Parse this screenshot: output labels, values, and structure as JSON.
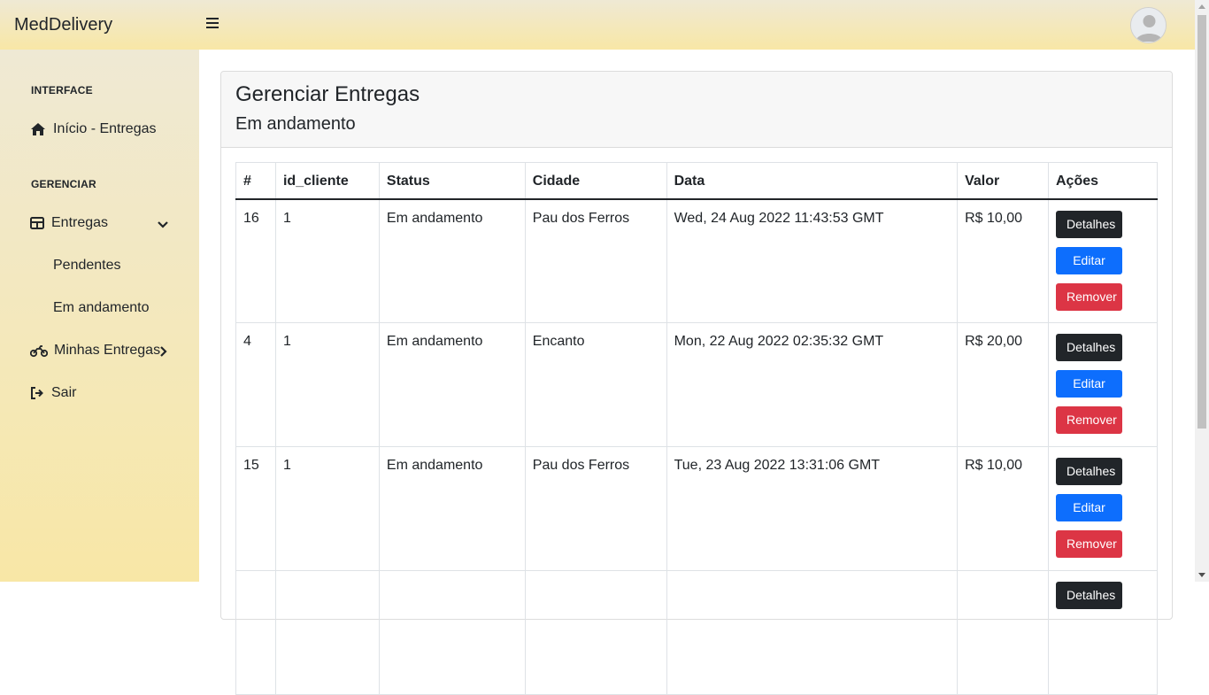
{
  "app": {
    "brand": "MedDelivery"
  },
  "sidebar": {
    "heading_interface": "INTERFACE",
    "inicio": "Início - Entregas",
    "heading_gerenciar": "GERENCIAR",
    "entregas": "Entregas",
    "sub_pendentes": "Pendentes",
    "sub_em_andamento": "Em andamento",
    "minhas_entregas": "Minhas Entregas",
    "sair": "Sair"
  },
  "page": {
    "title": "Gerenciar Entregas",
    "subtitle": "Em andamento"
  },
  "table": {
    "headers": [
      "#",
      "id_cliente",
      "Status",
      "Cidade",
      "Data",
      "Valor",
      "Ações"
    ],
    "rows": [
      {
        "id": "16",
        "id_cliente": "1",
        "status": "Em andamento",
        "cidade": "Pau dos Ferros",
        "data": "Wed, 24 Aug 2022 11:43:53 GMT",
        "valor": "R$ 10,00"
      },
      {
        "id": "4",
        "id_cliente": "1",
        "status": "Em andamento",
        "cidade": "Encanto",
        "data": "Mon, 22 Aug 2022 02:35:32 GMT",
        "valor": "R$ 20,00"
      },
      {
        "id": "15",
        "id_cliente": "1",
        "status": "Em andamento",
        "cidade": "Pau dos Ferros",
        "data": "Tue, 23 Aug 2022 13:31:06 GMT",
        "valor": "R$ 10,00"
      }
    ],
    "actions": {
      "detalhes": "Detalhes",
      "editar": "Editar",
      "remover": "Remover"
    }
  },
  "colors": {
    "sidebar_top": "#efe9d4",
    "sidebar_bottom": "#f8e7a6",
    "btn_dark": "#212529",
    "btn_primary": "#0d6efd",
    "btn_danger": "#dc3545"
  },
  "icons": {
    "menu": "hamburger-icon",
    "avatar": "user-avatar-icon",
    "inicio": "home-icon",
    "entregas": "table-icon",
    "minhas_entregas": "motorcycle-icon",
    "sair": "sign-out-icon",
    "expand": "chevron-down-icon",
    "submenu": "chevron-right-icon"
  }
}
